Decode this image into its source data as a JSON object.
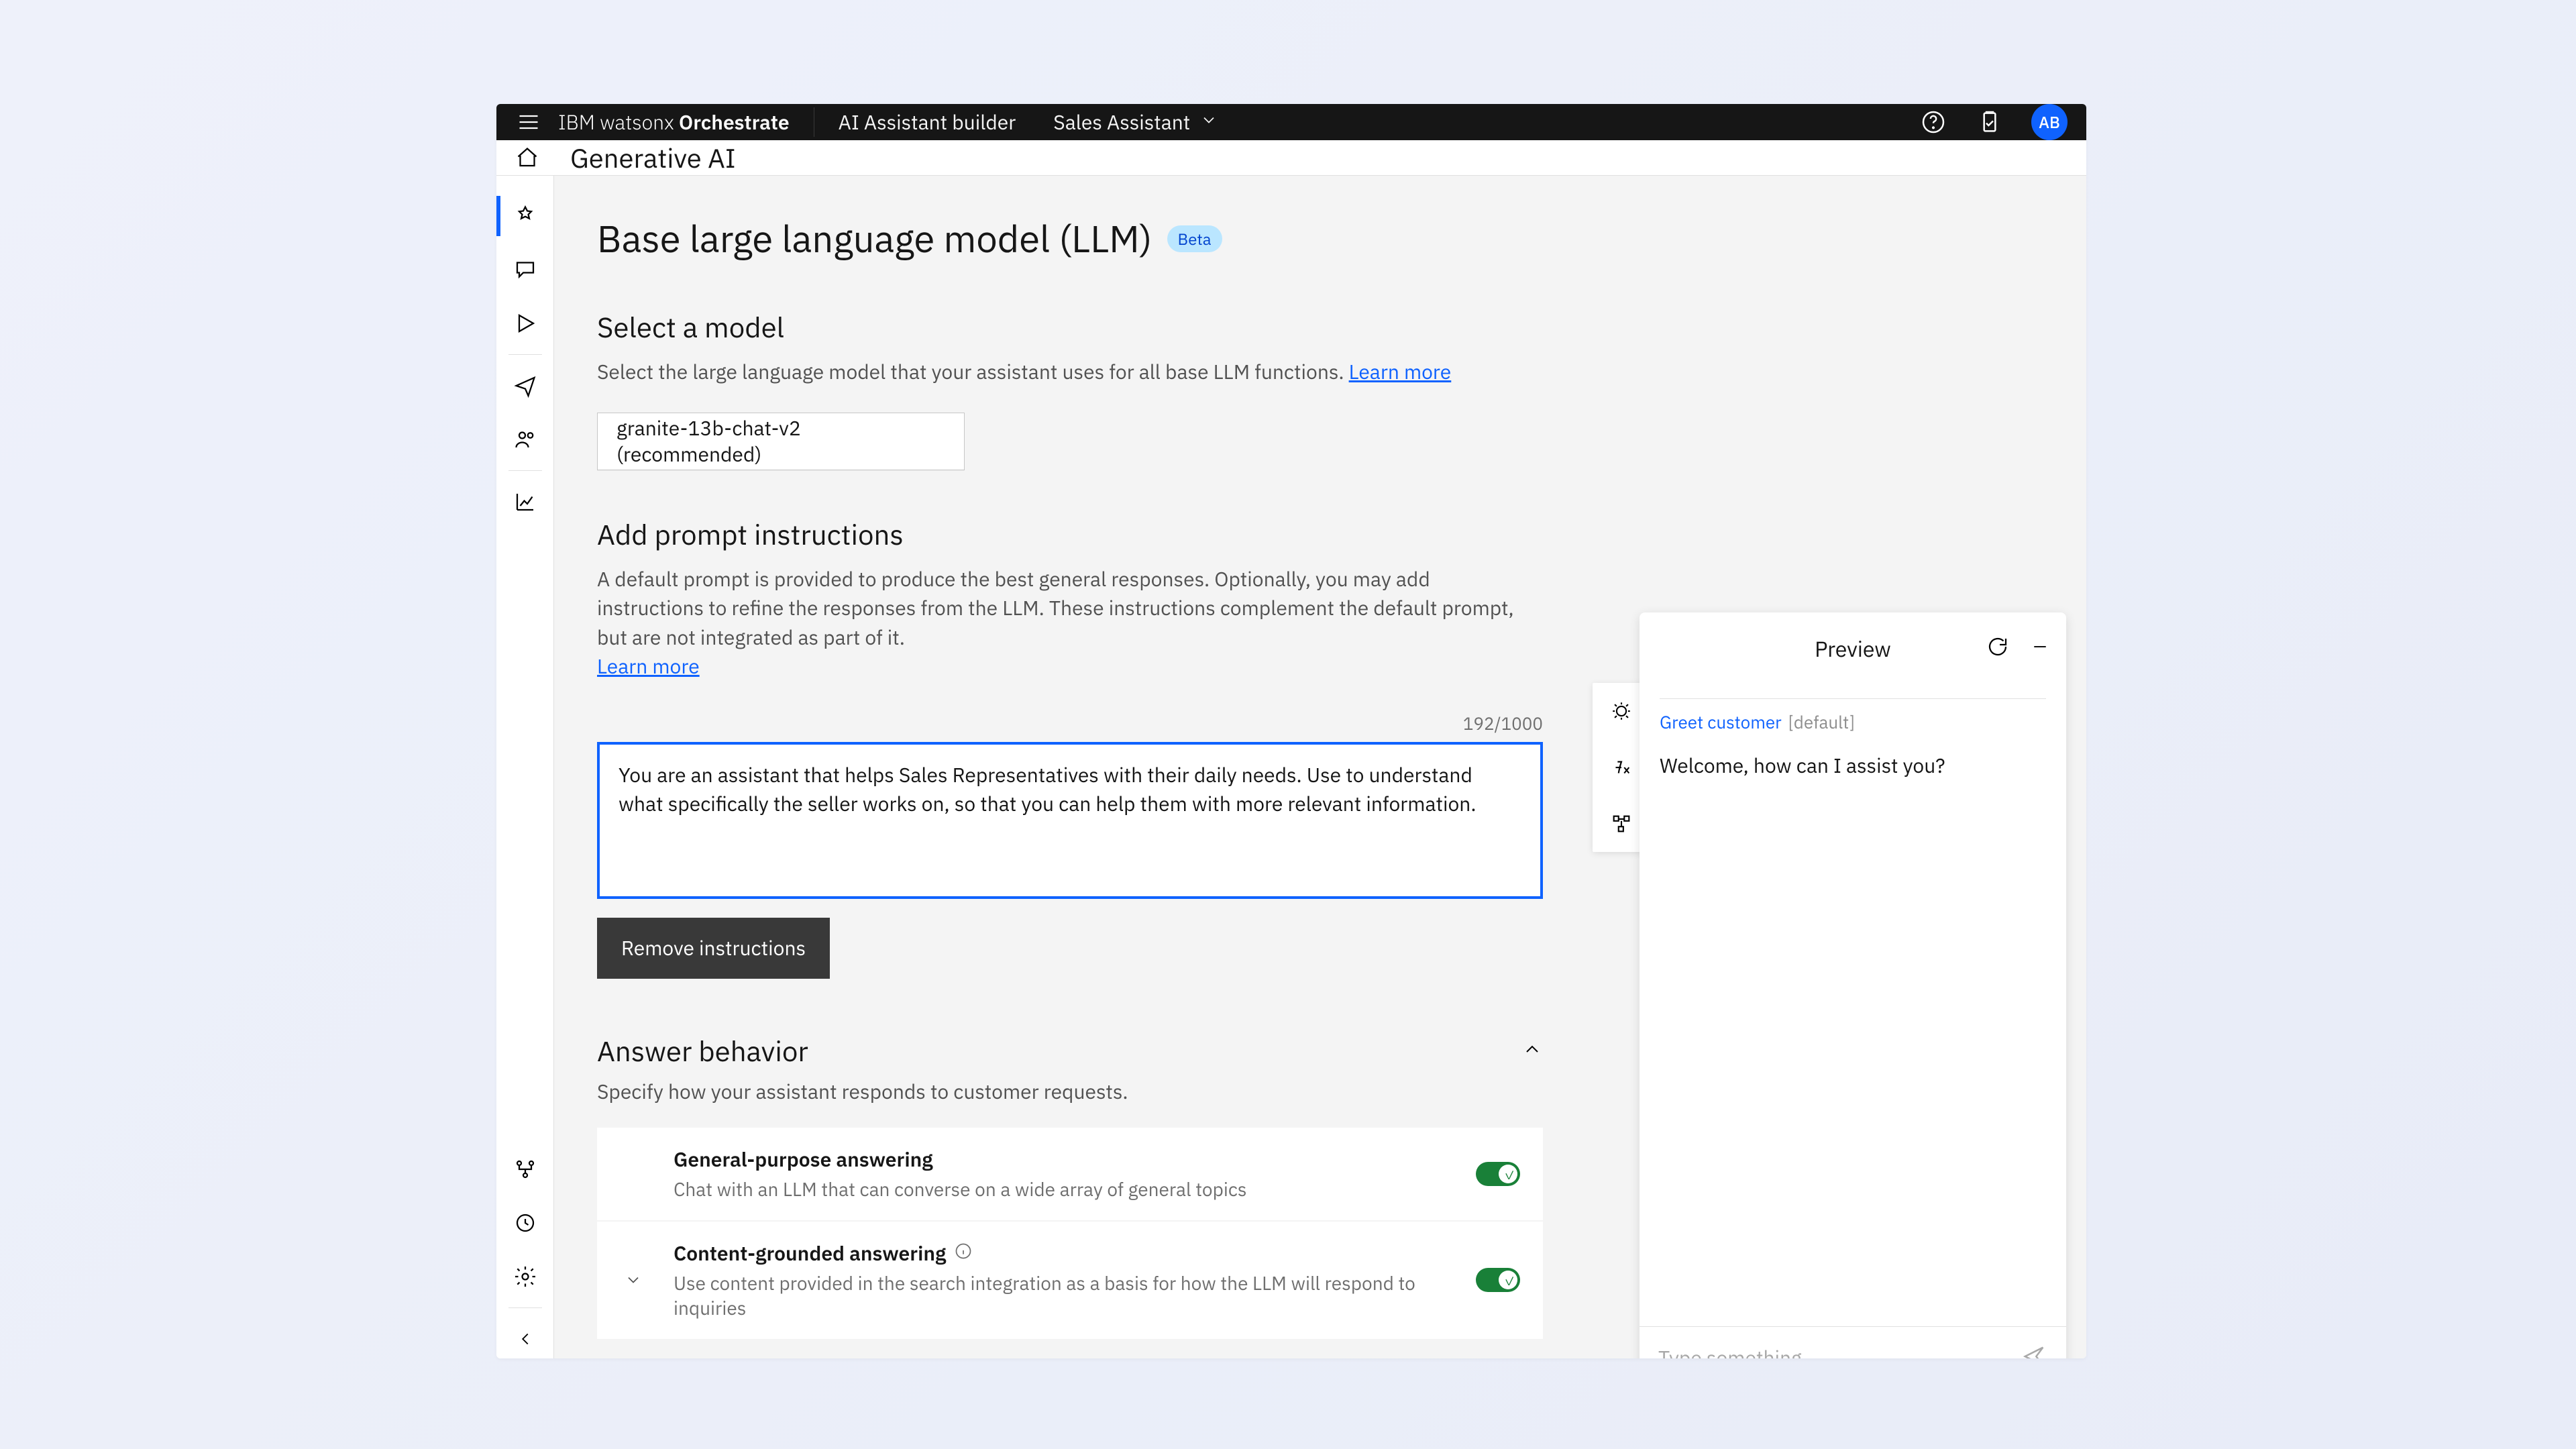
{
  "topbar": {
    "brand_prefix": "IBM ",
    "brand_light": "watsonx",
    "brand_bold": " Orchestrate",
    "builder": "AI Assistant builder",
    "assistant": "Sales Assistant",
    "avatar": "AB"
  },
  "subheader": {
    "title": "Generative AI"
  },
  "content": {
    "h1": "Base large language model (LLM)",
    "beta": "Beta",
    "select_h": "Select a model",
    "select_desc": "Select the large language model that your assistant uses for all base LLM functions. ",
    "learn_more": "Learn more",
    "model_value": "granite-13b-chat-v2 (recommended)",
    "prompt_h": "Add prompt instructions",
    "prompt_desc": "A default prompt is provided to produce the best general responses. Optionally, you may add instructions to refine the responses from the LLM. These instructions complement the default prompt, but are not integrated as part of it.",
    "char_count": "192/1000",
    "prompt_value": "You are an assistant that helps Sales Representatives with their daily needs. Use to understand what specifically the seller works on, so that you can help them with more relevant information.",
    "remove_btn": "Remove instructions",
    "answer_h": "Answer behavior",
    "answer_desc": "Specify how your assistant responds to customer requests.",
    "behav1_label": "General-purpose answering",
    "behav1_sub": "Chat with an LLM that can converse on a wide array of general topics",
    "behav2_label": "Content-grounded answering",
    "behav2_sub": "Use content provided in the search integration as a basis for how the LLM will respond to inquiries"
  },
  "preview": {
    "title": "Preview",
    "greet": "Greet customer",
    "default": "[default]",
    "welcome": "Welcome, how can I assist you?",
    "placeholder": "Type something..."
  }
}
